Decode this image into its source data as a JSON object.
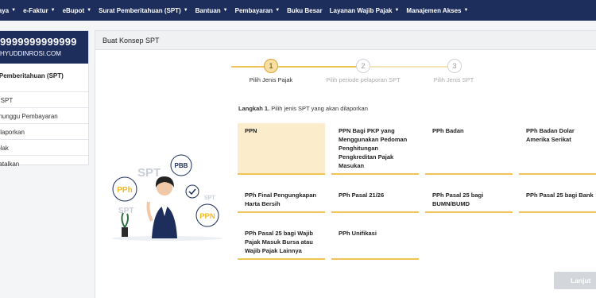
{
  "nav": [
    {
      "label": "l Saya",
      "caret": true
    },
    {
      "label": "e-Faktur",
      "caret": true
    },
    {
      "label": "eBupot",
      "caret": true
    },
    {
      "label": "Surat Pemberitahuan (SPT)",
      "caret": true
    },
    {
      "label": "Bantuan",
      "caret": true
    },
    {
      "label": "Pembayaran",
      "caret": true
    },
    {
      "label": "Buku Besar",
      "caret": false
    },
    {
      "label": "Layanan Wajib Pajak",
      "caret": true
    },
    {
      "label": "Manajemen Akses",
      "caret": true
    }
  ],
  "profile": {
    "npwp": "9999999999999",
    "name": "HYUDDINROSI.COM"
  },
  "sidebar": {
    "section": "t Pemberitahuan (SPT)",
    "items": [
      "p SPT",
      "enunggu Pembayaran",
      "dilaporkan",
      "tolak",
      "batalkan"
    ]
  },
  "main": {
    "title": "Buat Konsep SPT"
  },
  "stepper": [
    {
      "num": "1",
      "label": "Pilih Jenis Pajak",
      "active": true
    },
    {
      "num": "2",
      "label": "Pilih periode pelaporan SPT",
      "active": false
    },
    {
      "num": "3",
      "label": "Pilih Jenis SPT",
      "active": false
    }
  ],
  "instruction": {
    "step": "Langkah 1.",
    "text": "Pilih jenis SPT yang akan dilaporkan"
  },
  "cards": [
    "PPN",
    "PPN Bagi PKP yang Menggunakan Pedoman Penghitungan Pengkreditan Pajak Masukan",
    "PPh Badan",
    "PPh Badan Dolar Amerika Serikat",
    "PPh Final Pengungkapan Harta Bersih",
    "PPh Pasal 21/26",
    "PPh Pasal 25 bagi BUMN/BUMD",
    "PPh Pasal 25 bagi Bank",
    "PPh Pasal 25 bagi Wajib Pajak Masuk Bursa atau Wajib Pajak Lainnya",
    "PPh Unifikasi"
  ],
  "illustration": {
    "labels": [
      "SPT",
      "PBB",
      "PPh",
      "SPT",
      "SPT",
      "PPN"
    ]
  },
  "next_button": "Lanjut",
  "colors": {
    "navy": "#1d2e5c",
    "accent": "#efc356",
    "selected_card": "#fbeccc"
  }
}
